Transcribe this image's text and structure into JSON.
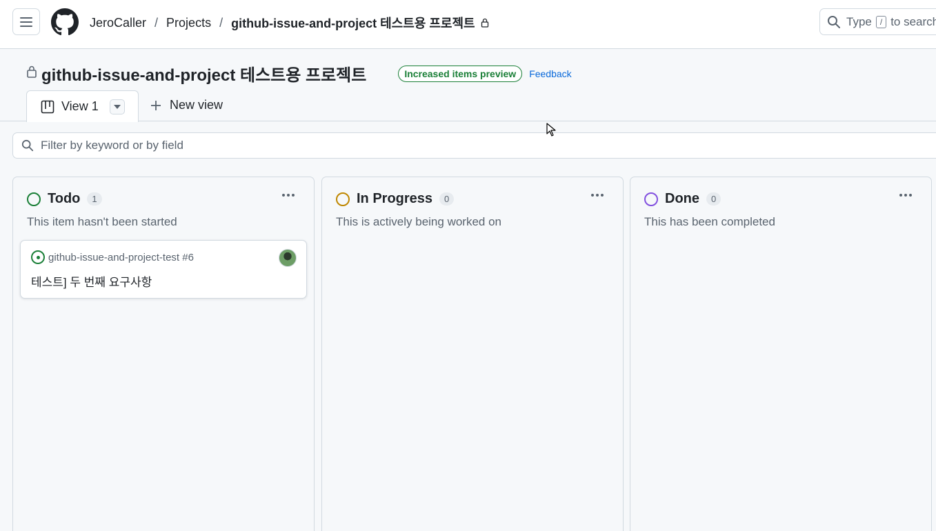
{
  "header": {
    "breadcrumbs": [
      "JeroCaller",
      "Projects",
      "github-issue-and-project 테스트용 프로젝트"
    ],
    "separator": "/",
    "search": {
      "prefix": "Type",
      "key": "/",
      "suffix": "to search"
    }
  },
  "project": {
    "title": "github-issue-and-project 테스트용 프로젝트",
    "badge": "Increased items preview",
    "feedback": "Feedback",
    "tabs": [
      {
        "label": "View 1",
        "active": true
      }
    ],
    "new_view": "New view"
  },
  "filter": {
    "placeholder": "Filter by keyword or by field"
  },
  "columns": [
    {
      "name": "Todo",
      "count": "1",
      "color": "#1a7f37",
      "description": "This item hasn't been started",
      "cards": [
        {
          "repo": "github-issue-and-project-test #6",
          "title": "테스트] 두 번째 요구사항"
        }
      ]
    },
    {
      "name": "In Progress",
      "count": "0",
      "color": "#bf8700",
      "description": "This is actively being worked on",
      "cards": []
    },
    {
      "name": "Done",
      "count": "0",
      "color": "#8250df",
      "description": "This has been completed",
      "cards": []
    }
  ]
}
